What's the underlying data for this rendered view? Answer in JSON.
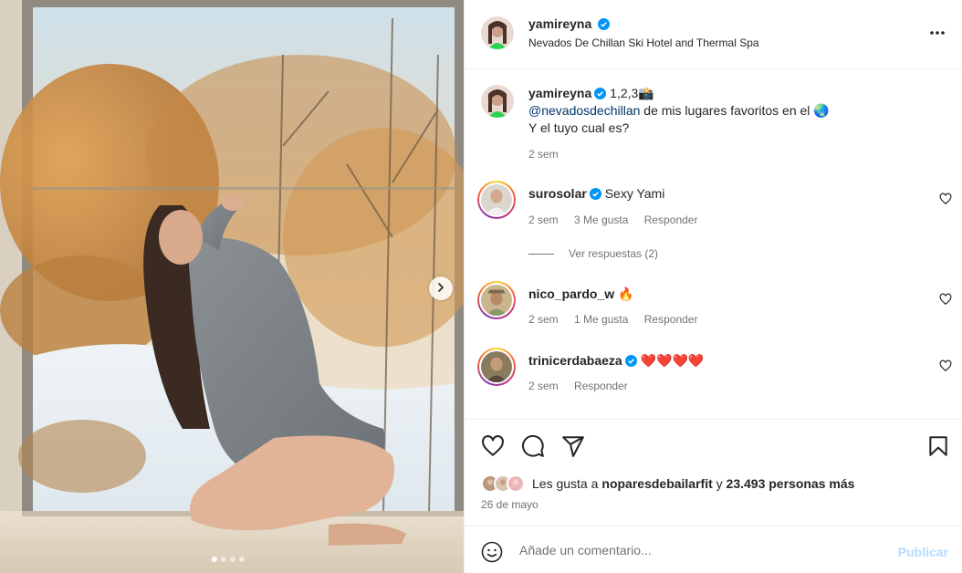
{
  "post": {
    "username": "yamireyna",
    "verified": true,
    "location": "Nevados De Chillan Ski Hotel and Thermal Spa",
    "more_icon": "more-horizontal-icon"
  },
  "media": {
    "next_icon": "chevron-right-icon",
    "slide_count": 4,
    "active_slide": 1
  },
  "caption": {
    "username": "yamireyna",
    "text_inline": "1,2,3📸",
    "mention": "@nevadosdechillan",
    "line1_rest": " de mis lugares favoritos en el 🌏",
    "line2": "Y el tuyo cual es?",
    "time": "2 sem"
  },
  "comments": [
    {
      "username": "surosolar",
      "verified": true,
      "text": "Sexy Yami",
      "time": "2 sem",
      "likes": "3 Me gusta",
      "reply": "Responder",
      "view_replies": "Ver respuestas (2)"
    },
    {
      "username": "nico_pardo_w",
      "verified": false,
      "text": "🔥",
      "time": "2 sem",
      "likes": "1 Me gusta",
      "reply": "Responder"
    },
    {
      "username": "trinicerdabaeza",
      "verified": true,
      "text": "❤️❤️❤️❤️",
      "time": "2 sem",
      "reply": "Responder"
    }
  ],
  "actions": {
    "like_icon": "heart-icon",
    "comment_icon": "comment-icon",
    "share_icon": "share-icon",
    "save_icon": "bookmark-icon"
  },
  "likes": {
    "prefix": "Les gusta a ",
    "user": "noparesdebailarfit",
    "middle": " y ",
    "count": "23.493 personas más"
  },
  "date": "26 de mayo",
  "comment_box": {
    "placeholder": "Añade un comentario...",
    "publish": "Publicar",
    "emoji_icon": "emoji-smile-icon"
  },
  "colors": {
    "verified": "#0095f6",
    "text": "#262626",
    "secondary": "#737373",
    "publish_disabled": "#b3dbff",
    "mention": "#00376b"
  }
}
